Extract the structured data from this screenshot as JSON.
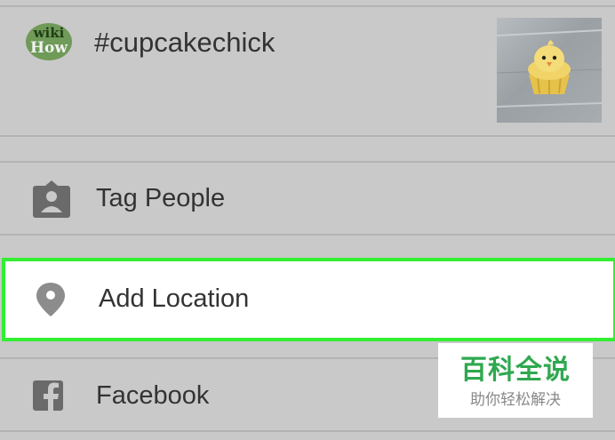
{
  "post": {
    "avatar_text_top": "wiki",
    "avatar_text_bottom": "How",
    "caption": "#cupcakechick"
  },
  "rows": {
    "tag_people": "Tag People",
    "add_location": "Add Location",
    "facebook": "Facebook"
  },
  "watermark": {
    "title": "百科全说",
    "subtitle": "助你轻松解决"
  },
  "colors": {
    "background": "#c9c9c9",
    "highlight_border": "#33ee33",
    "icon_gray": "#6a6a6a",
    "watermark_green": "#2fa84f"
  }
}
